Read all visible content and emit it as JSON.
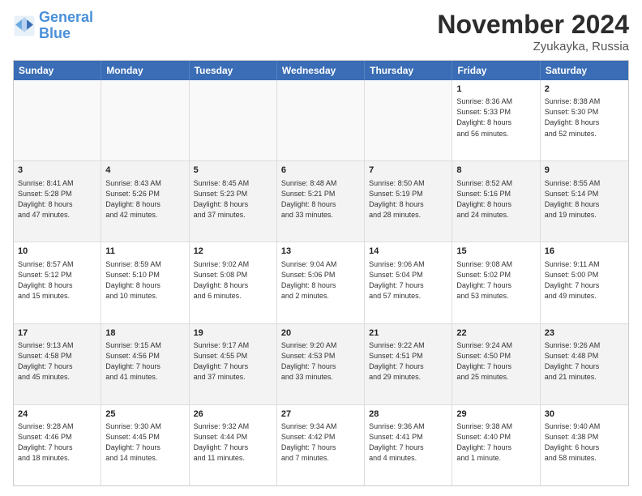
{
  "logo": {
    "line1": "General",
    "line2": "Blue"
  },
  "title": "November 2024",
  "location": "Zyukayka, Russia",
  "headers": [
    "Sunday",
    "Monday",
    "Tuesday",
    "Wednesday",
    "Thursday",
    "Friday",
    "Saturday"
  ],
  "rows": [
    [
      {
        "day": "",
        "text": ""
      },
      {
        "day": "",
        "text": ""
      },
      {
        "day": "",
        "text": ""
      },
      {
        "day": "",
        "text": ""
      },
      {
        "day": "",
        "text": ""
      },
      {
        "day": "1",
        "text": "Sunrise: 8:36 AM\nSunset: 5:33 PM\nDaylight: 8 hours\nand 56 minutes."
      },
      {
        "day": "2",
        "text": "Sunrise: 8:38 AM\nSunset: 5:30 PM\nDaylight: 8 hours\nand 52 minutes."
      }
    ],
    [
      {
        "day": "3",
        "text": "Sunrise: 8:41 AM\nSunset: 5:28 PM\nDaylight: 8 hours\nand 47 minutes."
      },
      {
        "day": "4",
        "text": "Sunrise: 8:43 AM\nSunset: 5:26 PM\nDaylight: 8 hours\nand 42 minutes."
      },
      {
        "day": "5",
        "text": "Sunrise: 8:45 AM\nSunset: 5:23 PM\nDaylight: 8 hours\nand 37 minutes."
      },
      {
        "day": "6",
        "text": "Sunrise: 8:48 AM\nSunset: 5:21 PM\nDaylight: 8 hours\nand 33 minutes."
      },
      {
        "day": "7",
        "text": "Sunrise: 8:50 AM\nSunset: 5:19 PM\nDaylight: 8 hours\nand 28 minutes."
      },
      {
        "day": "8",
        "text": "Sunrise: 8:52 AM\nSunset: 5:16 PM\nDaylight: 8 hours\nand 24 minutes."
      },
      {
        "day": "9",
        "text": "Sunrise: 8:55 AM\nSunset: 5:14 PM\nDaylight: 8 hours\nand 19 minutes."
      }
    ],
    [
      {
        "day": "10",
        "text": "Sunrise: 8:57 AM\nSunset: 5:12 PM\nDaylight: 8 hours\nand 15 minutes."
      },
      {
        "day": "11",
        "text": "Sunrise: 8:59 AM\nSunset: 5:10 PM\nDaylight: 8 hours\nand 10 minutes."
      },
      {
        "day": "12",
        "text": "Sunrise: 9:02 AM\nSunset: 5:08 PM\nDaylight: 8 hours\nand 6 minutes."
      },
      {
        "day": "13",
        "text": "Sunrise: 9:04 AM\nSunset: 5:06 PM\nDaylight: 8 hours\nand 2 minutes."
      },
      {
        "day": "14",
        "text": "Sunrise: 9:06 AM\nSunset: 5:04 PM\nDaylight: 7 hours\nand 57 minutes."
      },
      {
        "day": "15",
        "text": "Sunrise: 9:08 AM\nSunset: 5:02 PM\nDaylight: 7 hours\nand 53 minutes."
      },
      {
        "day": "16",
        "text": "Sunrise: 9:11 AM\nSunset: 5:00 PM\nDaylight: 7 hours\nand 49 minutes."
      }
    ],
    [
      {
        "day": "17",
        "text": "Sunrise: 9:13 AM\nSunset: 4:58 PM\nDaylight: 7 hours\nand 45 minutes."
      },
      {
        "day": "18",
        "text": "Sunrise: 9:15 AM\nSunset: 4:56 PM\nDaylight: 7 hours\nand 41 minutes."
      },
      {
        "day": "19",
        "text": "Sunrise: 9:17 AM\nSunset: 4:55 PM\nDaylight: 7 hours\nand 37 minutes."
      },
      {
        "day": "20",
        "text": "Sunrise: 9:20 AM\nSunset: 4:53 PM\nDaylight: 7 hours\nand 33 minutes."
      },
      {
        "day": "21",
        "text": "Sunrise: 9:22 AM\nSunset: 4:51 PM\nDaylight: 7 hours\nand 29 minutes."
      },
      {
        "day": "22",
        "text": "Sunrise: 9:24 AM\nSunset: 4:50 PM\nDaylight: 7 hours\nand 25 minutes."
      },
      {
        "day": "23",
        "text": "Sunrise: 9:26 AM\nSunset: 4:48 PM\nDaylight: 7 hours\nand 21 minutes."
      }
    ],
    [
      {
        "day": "24",
        "text": "Sunrise: 9:28 AM\nSunset: 4:46 PM\nDaylight: 7 hours\nand 18 minutes."
      },
      {
        "day": "25",
        "text": "Sunrise: 9:30 AM\nSunset: 4:45 PM\nDaylight: 7 hours\nand 14 minutes."
      },
      {
        "day": "26",
        "text": "Sunrise: 9:32 AM\nSunset: 4:44 PM\nDaylight: 7 hours\nand 11 minutes."
      },
      {
        "day": "27",
        "text": "Sunrise: 9:34 AM\nSunset: 4:42 PM\nDaylight: 7 hours\nand 7 minutes."
      },
      {
        "day": "28",
        "text": "Sunrise: 9:36 AM\nSunset: 4:41 PM\nDaylight: 7 hours\nand 4 minutes."
      },
      {
        "day": "29",
        "text": "Sunrise: 9:38 AM\nSunset: 4:40 PM\nDaylight: 7 hours\nand 1 minute."
      },
      {
        "day": "30",
        "text": "Sunrise: 9:40 AM\nSunset: 4:38 PM\nDaylight: 6 hours\nand 58 minutes."
      }
    ]
  ]
}
